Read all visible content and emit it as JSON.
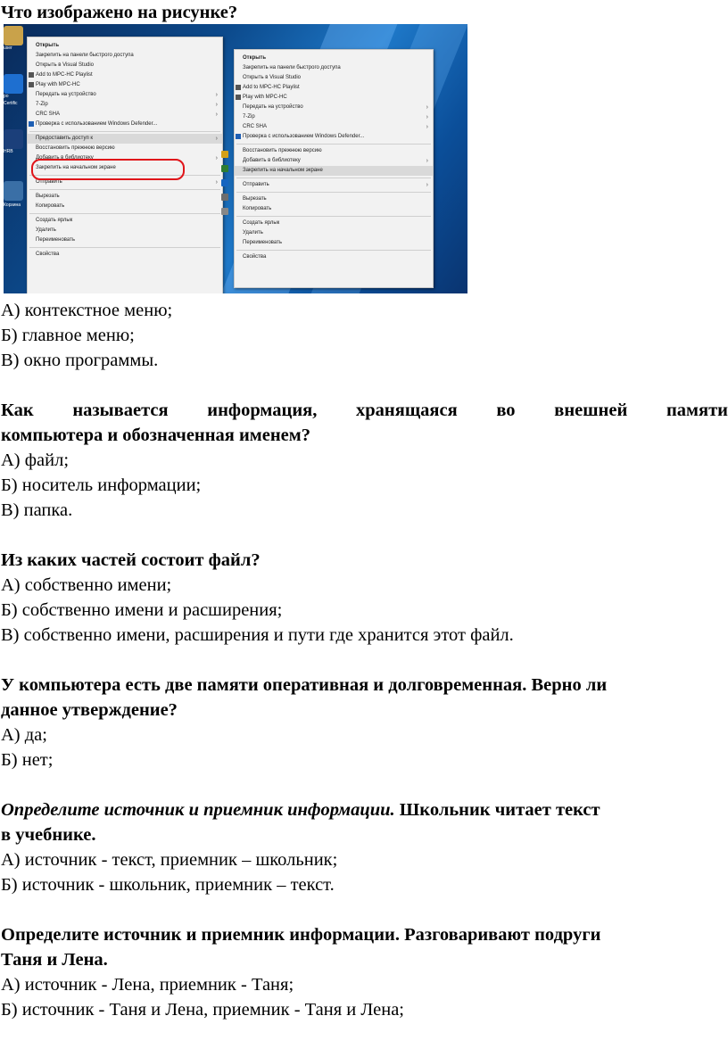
{
  "q1": {
    "question": "Что изображено на рисунке?",
    "options": [
      "А) контекстное меню;",
      "Б) главное меню;",
      "В) окно программы."
    ]
  },
  "screenshot": {
    "desktop_labels": [
      "user",
      "ро",
      "Certific",
      "HRB",
      "Корзина"
    ],
    "menu_left": [
      {
        "label": "Открыть",
        "bold": true
      },
      {
        "label": "Закрепить на панели быстрого доступа"
      },
      {
        "label": "Открыть в Visual Studio"
      },
      {
        "label": "Add to MPC-HC Playlist",
        "icon": "mpc"
      },
      {
        "label": "Play with MPC-HC",
        "icon": "mpc"
      },
      {
        "label": "Передать на устройство",
        "arrow": true
      },
      {
        "label": "7-Zip",
        "arrow": true
      },
      {
        "label": "CRC SHA",
        "arrow": true
      },
      {
        "label": "Проверка с использованием Windows Defender...",
        "icon": "defender"
      },
      {
        "label": "Предоставить доступ к",
        "arrow": true,
        "highlight": true
      },
      {
        "label": "Восстановить прежнюю версию"
      },
      {
        "label": "Добавить в библиотеку",
        "arrow": true
      },
      {
        "label": "Закрепить на начальном экране"
      },
      {
        "label": "Отправить",
        "arrow": true
      },
      {
        "label": "Вырезать"
      },
      {
        "label": "Копировать"
      },
      {
        "label": "Создать ярлык"
      },
      {
        "label": "Удалить"
      },
      {
        "label": "Переименовать"
      },
      {
        "label": "Свойства"
      }
    ],
    "menu_right": [
      {
        "label": "Открыть",
        "bold": true
      },
      {
        "label": "Закрепить на панели быстрого доступа"
      },
      {
        "label": "Открыть в Visual Studio"
      },
      {
        "label": "Add to MPC-HC Playlist",
        "icon": "mpc"
      },
      {
        "label": "Play with MPC-HC",
        "icon": "mpc"
      },
      {
        "label": "Передать на устройство",
        "arrow": true
      },
      {
        "label": "7-Zip",
        "arrow": true
      },
      {
        "label": "CRC SHA",
        "arrow": true
      },
      {
        "label": "Проверка с использованием Windows Defender...",
        "icon": "defender"
      },
      {
        "label": "Восстановить прежнюю версию"
      },
      {
        "label": "Добавить в библиотеку",
        "arrow": true
      },
      {
        "label": "Закрепить на начальном экране",
        "highlight": true
      },
      {
        "label": "Отправить",
        "arrow": true
      },
      {
        "label": "Вырезать"
      },
      {
        "label": "Копировать"
      },
      {
        "label": "Создать ярлык"
      },
      {
        "label": "Удалить"
      },
      {
        "label": "Переименовать"
      },
      {
        "label": "Свойства"
      }
    ]
  },
  "q2": {
    "question_line1": [
      "Как",
      "называется",
      "информация,",
      "хранящаяся",
      "во",
      "внешней",
      "памяти"
    ],
    "question_line2": "компьютера и обозначенная именем?",
    "options": [
      "А) файл;",
      "Б) носитель информации;",
      "В) папка."
    ]
  },
  "q3": {
    "question": "Из каких частей состоит файл?",
    "options": [
      "А) собственно имени;",
      "Б) собственно имени и расширения;",
      "В) собственно имени, расширения и пути где хранится этот файл."
    ]
  },
  "q4": {
    "question_line1": "У компьютера есть две памяти оперативная и долговременная. Верно ли",
    "question_line2": "данное утверждение?",
    "options": [
      "А) да;",
      "Б) нет;"
    ]
  },
  "q5": {
    "lead": "Определите источник и приемник информации.",
    "question_line1_rest": " Школьник читает текст",
    "question_line2": "в учебнике.",
    "options": [
      "А) источник - текст, приемник – школьник;",
      "Б) источник - школьник, приемник – текст."
    ]
  },
  "q6": {
    "question_line1": "Определите источник и приемник информации. Разговаривают подруги",
    "question_line2": "Таня и Лена.",
    "options": [
      "А) источник - Лена, приемник - Таня;",
      "Б) источник - Таня и Лена, приемник - Таня и Лена;"
    ]
  },
  "colors": {
    "highlight_ring": "#e0151a",
    "desktop": "#0c4a8c"
  }
}
